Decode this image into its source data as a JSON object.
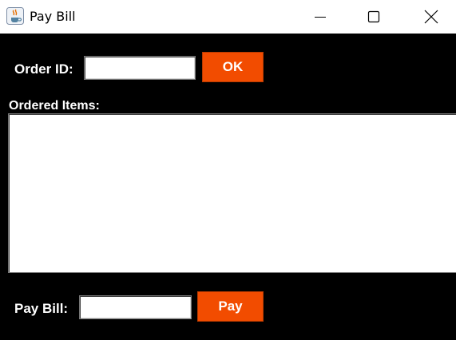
{
  "window": {
    "title": "Pay Bill",
    "app_icon": "java-cup-icon",
    "controls": {
      "minimize_icon": "minimize-icon",
      "maximize_icon": "maximize-icon",
      "close_icon": "close-icon"
    }
  },
  "order": {
    "label": "Order ID:",
    "value": "",
    "ok_label": "OK"
  },
  "items": {
    "label": "Ordered Items:",
    "value": ""
  },
  "pay": {
    "label": "Pay Bill:",
    "value": "",
    "button_label": "Pay"
  },
  "colors": {
    "background": "#000000",
    "accent": "#f24c00",
    "text": "#ffffff"
  }
}
